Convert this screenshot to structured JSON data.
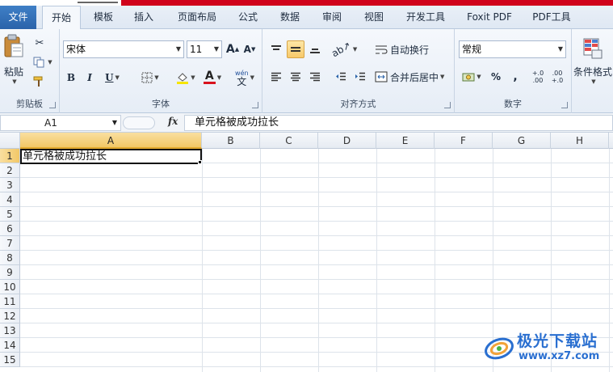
{
  "tabs": [
    {
      "label": "文件"
    },
    {
      "label": "开始"
    },
    {
      "label": "模板"
    },
    {
      "label": "插入"
    },
    {
      "label": "页面布局"
    },
    {
      "label": "公式"
    },
    {
      "label": "数据"
    },
    {
      "label": "审阅"
    },
    {
      "label": "视图"
    },
    {
      "label": "开发工具"
    },
    {
      "label": "Foxit PDF"
    },
    {
      "label": "PDF工具"
    }
  ],
  "ribbon": {
    "clipboard": {
      "paste_label": "粘贴",
      "group_label": "剪贴板"
    },
    "font": {
      "font_name": "宋体",
      "font_size": "11",
      "grow_label": "A",
      "shrink_label": "A",
      "bold": "B",
      "italic": "I",
      "underline": "U",
      "font_color_glyph": "A",
      "phonetic_top": "wén",
      "phonetic_bottom": "文",
      "group_label": "字体"
    },
    "alignment": {
      "wrap_text": "自动换行",
      "merge_center": "合并后居中",
      "group_label": "对齐方式"
    },
    "number": {
      "format": "常规",
      "percent": "%",
      "comma": ",",
      "inc_decimal": "+.0 .00",
      "dec_decimal": ".00 +.0",
      "group_label": "数字"
    },
    "styles": {
      "conditional_format": "条件格式"
    }
  },
  "formula_bar": {
    "name_box": "A1",
    "fx": "fx",
    "content": "单元格被成功拉长"
  },
  "grid": {
    "columns": [
      "A",
      "B",
      "C",
      "D",
      "E",
      "F",
      "G",
      "H"
    ],
    "rows": [
      "1",
      "2",
      "3",
      "4",
      "5",
      "6",
      "7",
      "8",
      "9",
      "10",
      "11",
      "12",
      "13",
      "14",
      "15"
    ],
    "selected_cell": "A1",
    "cells": {
      "A1": "单元格被成功拉长"
    }
  },
  "watermark": {
    "text": "极光下载站",
    "url": "www.xz7.com"
  },
  "colors": {
    "accent_red": "#d0021b",
    "file_tab": "#2a63aa",
    "selection_header": "#f2c766"
  }
}
